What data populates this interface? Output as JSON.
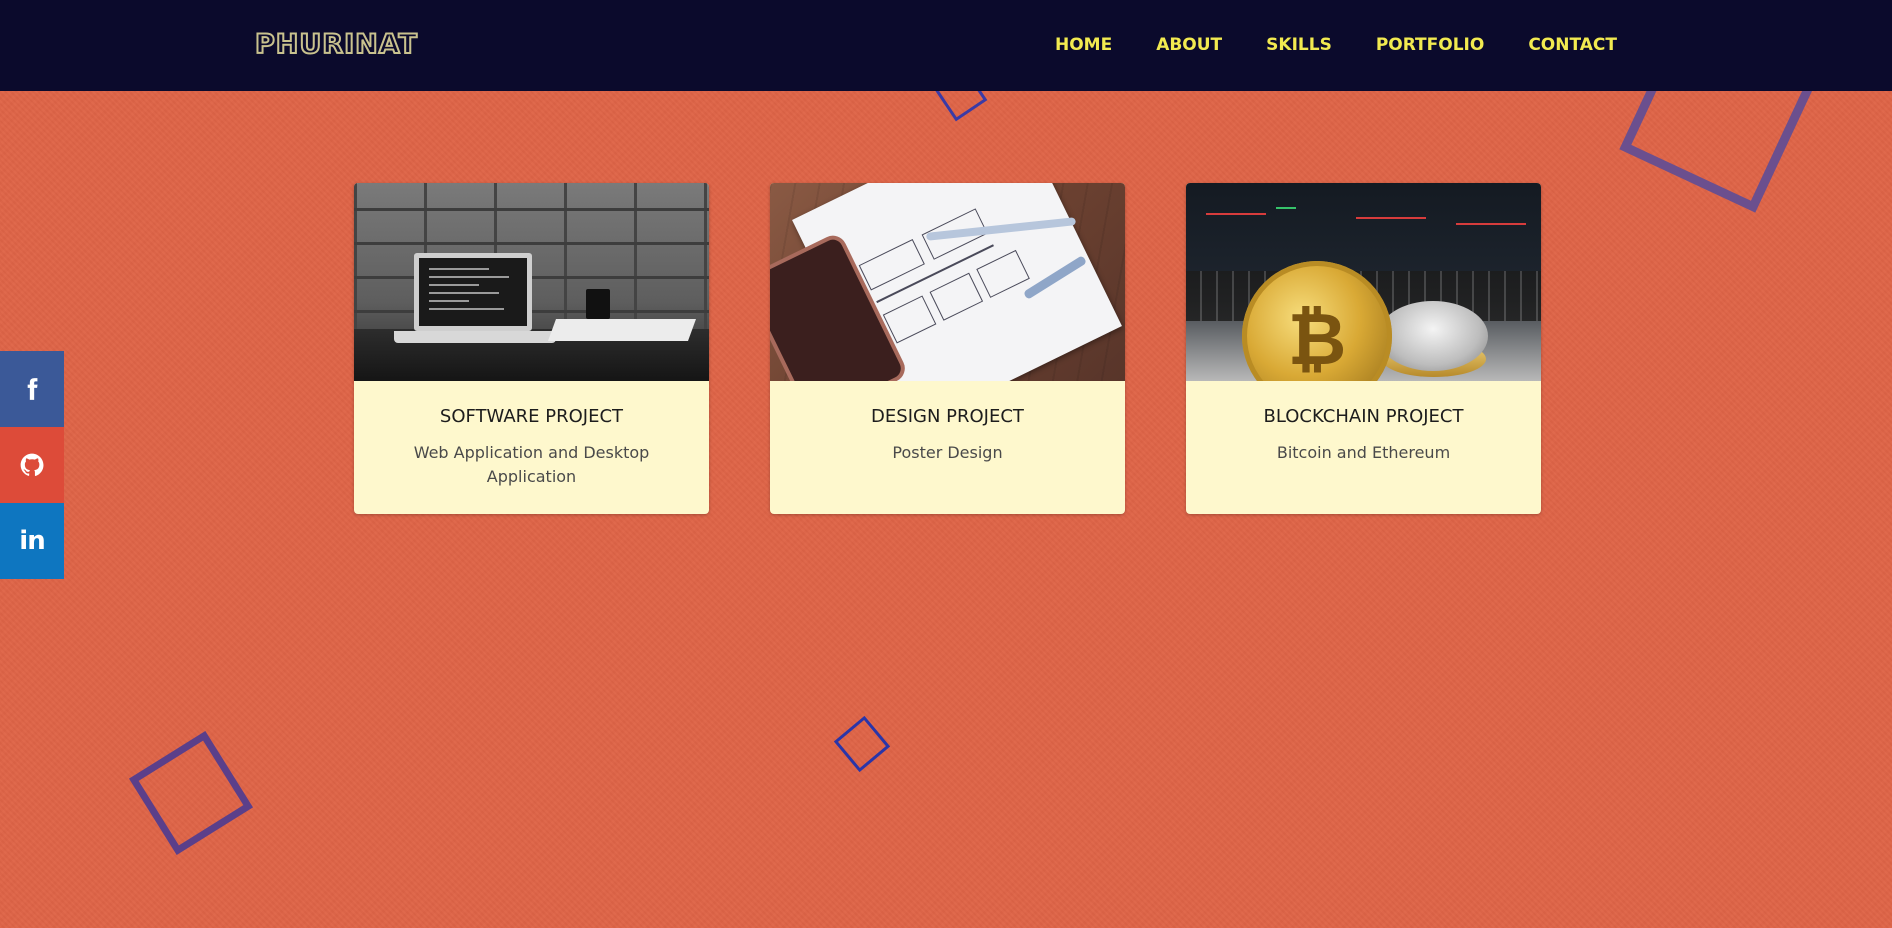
{
  "brand": {
    "name": "PHURINAT"
  },
  "nav": {
    "items": [
      {
        "label": "HOME"
      },
      {
        "label": "ABOUT"
      },
      {
        "label": "SKILLS"
      },
      {
        "label": "PORTFOLIO"
      },
      {
        "label": "CONTACT"
      }
    ]
  },
  "social": {
    "items": [
      {
        "icon": "facebook-icon",
        "color": "#3b5998"
      },
      {
        "icon": "github-icon",
        "color": "#dd4b39"
      },
      {
        "icon": "linkedin-icon",
        "color": "#0e76c0",
        "label": "in"
      }
    ]
  },
  "projects": [
    {
      "title": "SOFTWARE PROJECT",
      "description": "Web Application and Desktop Application"
    },
    {
      "title": "DESIGN PROJECT",
      "description": "Poster Design"
    },
    {
      "title": "BLOCKCHAIN PROJECT",
      "description": "Bitcoin and Ethereum"
    }
  ],
  "colors": {
    "background": "#df6447",
    "navbar": "#0b0a2c",
    "nav_text": "#f2ea50",
    "card": "#fef8cd"
  }
}
